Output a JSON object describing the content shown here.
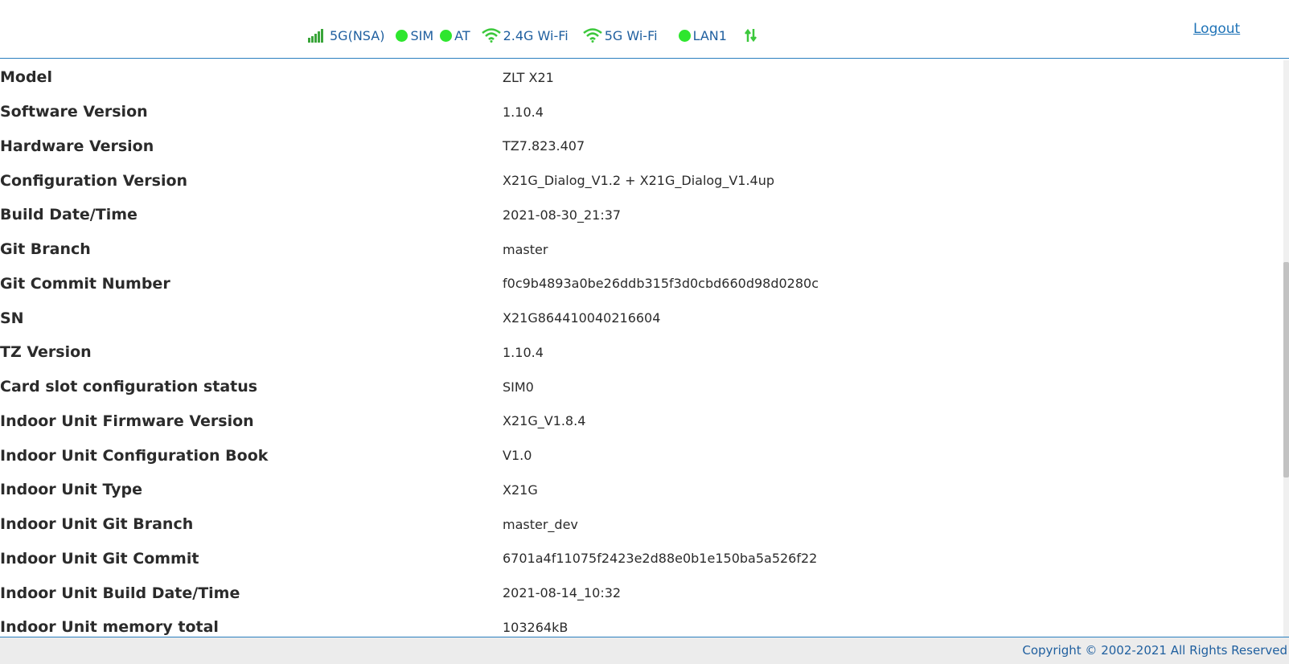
{
  "status_bar": {
    "items": [
      {
        "icon": "signal-bars-icon",
        "label": "5G(NSA)"
      },
      {
        "icon": "green-status-dot",
        "label": "SIM"
      },
      {
        "icon": "green-status-dot",
        "label": "AT"
      },
      {
        "icon": "wifi-icon",
        "label": "2.4G Wi-Fi"
      },
      {
        "icon": "wifi-icon",
        "label": "5G Wi-Fi"
      },
      {
        "icon": "green-status-dot",
        "label": "LAN1"
      },
      {
        "icon": "data-transfer-arrows-icon",
        "label": ""
      }
    ],
    "logout_label": "Logout"
  },
  "device_info": [
    {
      "label": "Model",
      "value": "ZLT X21"
    },
    {
      "label": "Software Version",
      "value": "1.10.4"
    },
    {
      "label": "Hardware Version",
      "value": "TZ7.823.407"
    },
    {
      "label": "Configuration Version",
      "value": "X21G_Dialog_V1.2 + X21G_Dialog_V1.4up"
    },
    {
      "label": "Build Date/Time",
      "value": "2021-08-30_21:37"
    },
    {
      "label": "Git Branch",
      "value": "master"
    },
    {
      "label": "Git Commit Number",
      "value": "f0c9b4893a0be26ddb315f3d0cbd660d98d0280c"
    },
    {
      "label": "SN",
      "value": "X21G864410040216604"
    },
    {
      "label": "TZ Version",
      "value": "1.10.4"
    },
    {
      "label": "Card slot configuration status",
      "value": "SIM0"
    },
    {
      "label": "Indoor Unit Firmware Version",
      "value": "X21G_V1.8.4"
    },
    {
      "label": "Indoor Unit Configuration Book",
      "value": "V1.0"
    },
    {
      "label": "Indoor Unit Type",
      "value": "X21G"
    },
    {
      "label": "Indoor Unit Git Branch",
      "value": "master_dev"
    },
    {
      "label": "Indoor Unit Git Commit",
      "value": "6701a4f11075f2423e2d88e0b1e150ba5a526f22"
    },
    {
      "label": "Indoor Unit Build Date/Time",
      "value": "2021-08-14_10:32"
    },
    {
      "label": "Indoor Unit memory total",
      "value": "103264kB"
    }
  ],
  "footer": {
    "copyright": "Copyright © 2002-2021 All Rights Reserved"
  },
  "colors": {
    "accent_blue": "#1f73b7",
    "status_green": "#2ee62e",
    "signal_green": "#3aa53a"
  }
}
